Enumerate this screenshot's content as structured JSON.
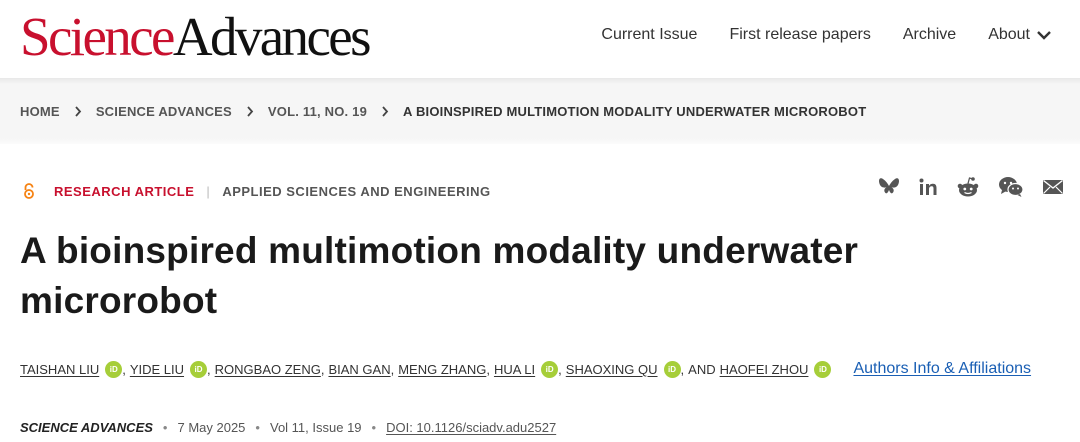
{
  "header": {
    "logo_part1": "Science",
    "logo_part2": "Advances",
    "nav": [
      "Current Issue",
      "First release papers",
      "Archive",
      "About"
    ]
  },
  "breadcrumb": [
    "HOME",
    "SCIENCE ADVANCES",
    "VOL. 11, NO. 19",
    "A BIOINSPIRED MULTIMOTION MODALITY UNDERWATER MICROROBOT"
  ],
  "article": {
    "type": "RESEARCH ARTICLE",
    "subject": "APPLIED SCIENCES AND ENGINEERING",
    "title_line1": "A bioinspired multimotion modality underwater",
    "title_line2": "microrobot",
    "authors": [
      "TAISHAN LIU",
      "YIDE LIU",
      "RONGBAO ZENG",
      "BIAN GAN",
      "MENG ZHANG",
      "HUA LI",
      "SHAOXING QU",
      "HAOFEI ZHOU"
    ],
    "orcid_label": "iD",
    "and_text": "AND",
    "affiliations_link": "Authors Info & Affiliations",
    "journal": "SCIENCE ADVANCES",
    "date": "7 May 2025",
    "volume_issue": "Vol 11, Issue 19",
    "doi": "DOI: 10.1126/sciadv.adu2527"
  },
  "share_icons": [
    "bluesky-icon",
    "linkedin-icon",
    "reddit-icon",
    "wechat-icon",
    "email-icon"
  ],
  "colors": {
    "brand_red": "#c8102e",
    "link_blue": "#1a5fb4",
    "orcid_green": "#a6ce39",
    "open_access_orange": "#f68212"
  }
}
